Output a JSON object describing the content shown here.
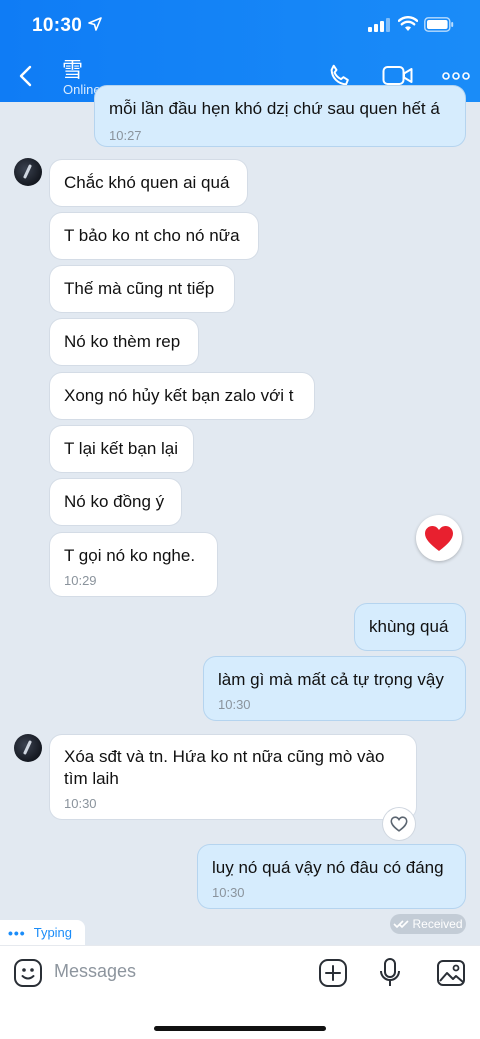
{
  "status_bar": {
    "time": "10:30"
  },
  "header": {
    "contact_name": "雪",
    "presence": "Online Just Now"
  },
  "messages": {
    "m0": {
      "text": "mỗi lần đầu hẹn khó dzị chứ sau quen hết á",
      "time": "10:27"
    },
    "m1": {
      "text": "Chắc khó quen ai quá"
    },
    "m2": {
      "text": "T bảo ko nt cho nó nữa"
    },
    "m3": {
      "text": "Thế mà cũng nt tiếp"
    },
    "m4": {
      "text": "Nó ko thèm rep"
    },
    "m5": {
      "text": "Xong nó hủy kết bạn zalo với t"
    },
    "m6": {
      "text": "T lại kết bạn lại"
    },
    "m7": {
      "text": "Nó ko đồng ý"
    },
    "m8": {
      "text": "T gọi nó ko nghe.",
      "time": "10:29"
    },
    "m9": {
      "text": "khùng quá"
    },
    "m10": {
      "text": "làm gì mà mất cả tự trọng vậy",
      "time": "10:30"
    },
    "m11": {
      "text": "Xóa sđt và tn.  Hứa ko nt nữa cũng mò vào tìm laih",
      "time": "10:30"
    },
    "m12": {
      "text": "luỵ nó quá vậy nó đâu có đáng",
      "time": "10:30"
    }
  },
  "received_label": "Received",
  "typing_label": "Typing",
  "input": {
    "placeholder": "Messages"
  },
  "colors": {
    "header": "#1a8cf8",
    "outgoing": "#d6ecfd",
    "incoming": "#ffffff",
    "background": "#e2e9f1",
    "reaction": "#e8202f"
  }
}
